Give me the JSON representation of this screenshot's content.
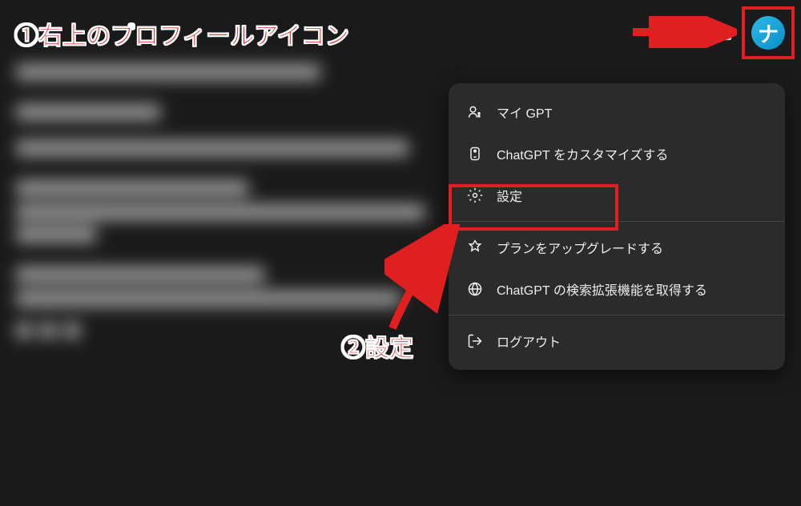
{
  "annotations": {
    "profile_label": "①右上のプロフィールアイコン",
    "settings_label": "②設定"
  },
  "avatar": {
    "letter": "ナ"
  },
  "menu": {
    "my_gpt": "マイ GPT",
    "customize": "ChatGPT をカスタマイズする",
    "settings": "設定",
    "upgrade": "プランをアップグレードする",
    "extension": "ChatGPT の検索拡張機能を取得する",
    "logout": "ログアウト"
  },
  "highlight_color": "#e02020"
}
